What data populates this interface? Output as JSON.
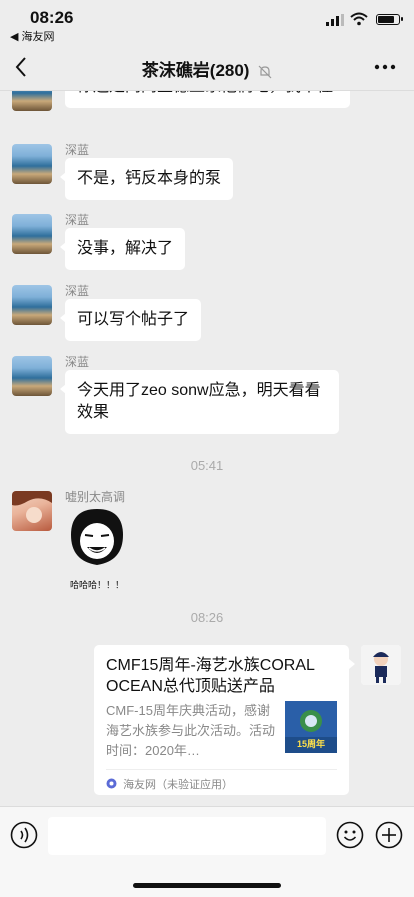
{
  "status": {
    "time": "08:26",
    "back_app": "◀ 海友网"
  },
  "nav": {
    "title": "茶沫礁岩(280)"
  },
  "messages": {
    "partial_text": "你还是问问墨德上家他们吧，我不懂",
    "m1": {
      "sender": "深蓝",
      "text": "不是，钙反本身的泵"
    },
    "m2": {
      "sender": "深蓝",
      "text": "没事，解决了"
    },
    "m3": {
      "sender": "深蓝",
      "text": "可以写个帖子了"
    },
    "m4": {
      "sender": "深蓝",
      "text": "今天用了zeo sonw应急，明天看看效果"
    },
    "ts1": "05:41",
    "m5": {
      "sender": "嘘别太高调",
      "sticker_caption": "哈哈哈！！！"
    },
    "ts2": "08:26",
    "card": {
      "title": "CMF15周年-海艺水族CORAL OCEAN总代顶贴送产品",
      "desc": "CMF-15周年庆典活动，感谢海艺水族参与此次活动。活动时间：2020年…",
      "source": "海友网（未验证应用）",
      "thumb_text": "15周年"
    }
  },
  "colors": {
    "bg": "#ededed",
    "bubble": "#ffffff",
    "meta": "#888888",
    "thumb": "#2a5fa8"
  }
}
